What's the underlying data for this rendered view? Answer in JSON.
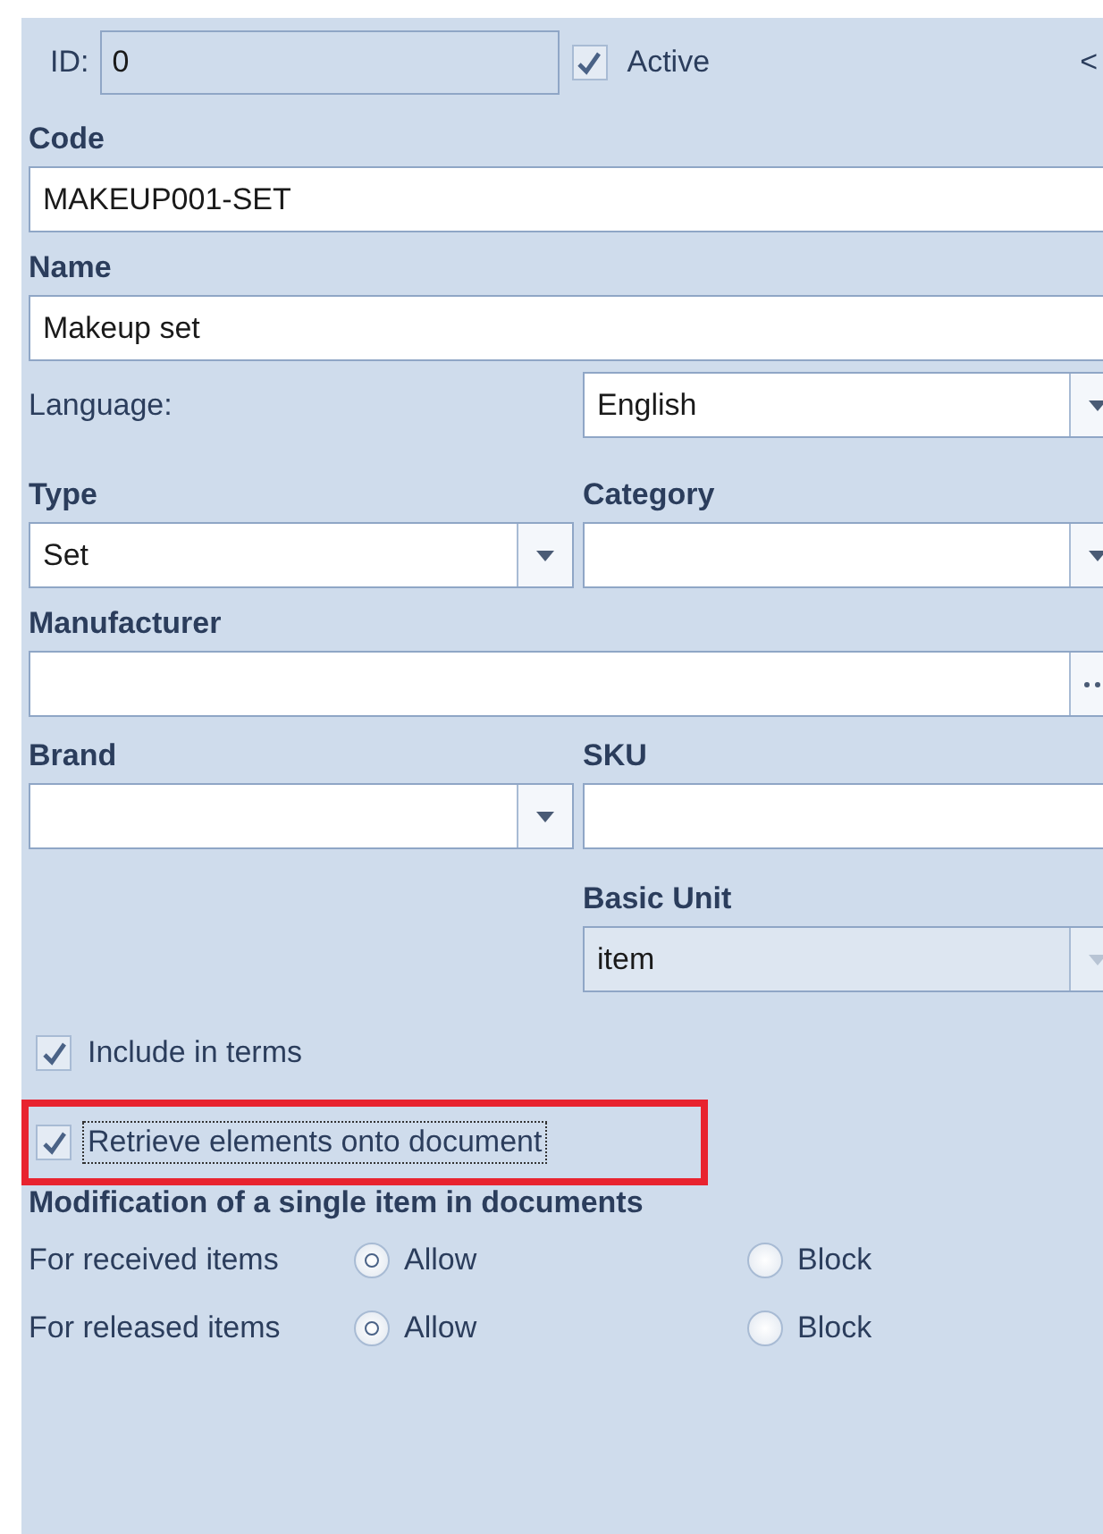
{
  "panel": {
    "id_field": {
      "label": "ID:",
      "value": "0"
    },
    "active": {
      "label": "Active",
      "checked": true
    },
    "collapse": "<",
    "code": {
      "label": "Code",
      "value": "MAKEUP001-SET"
    },
    "name": {
      "label": "Name",
      "value": "Makeup set"
    },
    "language": {
      "label": "Language:",
      "value": "English"
    },
    "type": {
      "label": "Type",
      "value": "Set"
    },
    "category": {
      "label": "Category"
    },
    "manufacturer": {
      "label": "Manufacturer"
    },
    "brand": {
      "label": "Brand"
    },
    "sku": {
      "label": "SKU"
    },
    "basic_unit": {
      "label": "Basic Unit",
      "value": "item",
      "disabled": true
    },
    "checkboxes": [
      {
        "label": "Include in terms",
        "checked": true,
        "focused": false,
        "highlighted": false
      },
      {
        "label": "Retrieve elements onto document",
        "checked": true,
        "focused": true,
        "highlighted": true
      }
    ],
    "modification": {
      "title": "Modification of a single item in documents",
      "rows": [
        {
          "label": "For received items",
          "options": [
            {
              "label": "Allow",
              "selected": true
            },
            {
              "label": "Block",
              "selected": false
            }
          ]
        },
        {
          "label": "For released items",
          "options": [
            {
              "label": "Allow",
              "selected": true
            },
            {
              "label": "Block",
              "selected": false
            }
          ]
        }
      ]
    }
  }
}
